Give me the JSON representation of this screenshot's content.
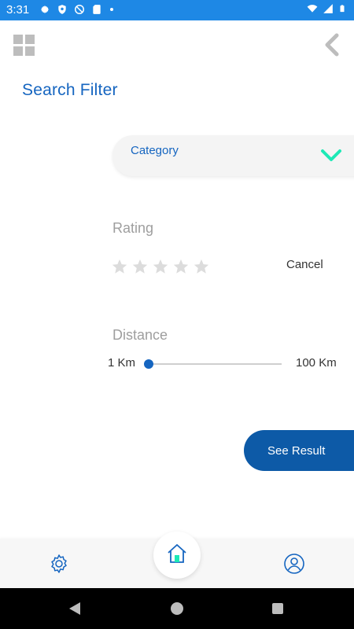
{
  "status_bar": {
    "time": "3:31",
    "left_icons": [
      "gear-icon",
      "shield-icon",
      "no-disturb-icon",
      "sd-card-icon",
      "dot-icon"
    ],
    "right_icons": [
      "wifi-icon",
      "signal-icon",
      "battery-icon"
    ]
  },
  "header": {
    "title": "Search Filter",
    "menu_icon": "grid-icon",
    "back_icon": "chevron-left-icon"
  },
  "filter": {
    "category_label": "Category",
    "rating_label": "Rating",
    "rating_value": 0,
    "rating_max": 5,
    "cancel_label": "Cancel",
    "distance_label": "Distance",
    "distance_min": "1 Km",
    "distance_max": "100 Km",
    "distance_value_fraction": 0
  },
  "actions": {
    "see_result_label": "See Result"
  },
  "bottom_nav": {
    "items": [
      "settings-icon",
      "home-icon",
      "profile-icon"
    ],
    "active": "home-icon"
  },
  "colors": {
    "primary": "#1565c0",
    "button": "#0d5aa7",
    "accent": "#1de9b6",
    "star_empty": "#dcdcdc",
    "muted_text": "#9e9e9e",
    "status_bar": "#1e88e5"
  }
}
